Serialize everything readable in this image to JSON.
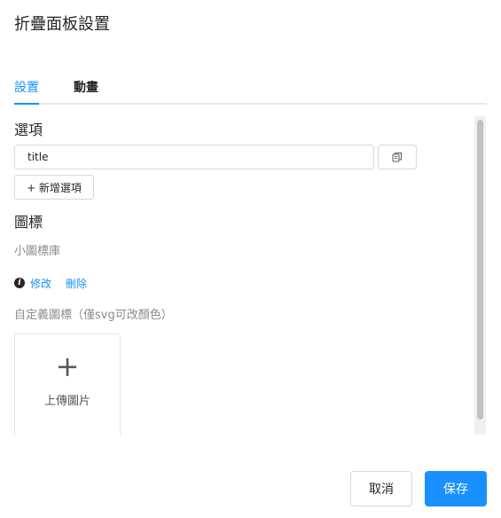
{
  "dialog": {
    "title": "折疊面板設置"
  },
  "tabs": [
    {
      "label": "設置",
      "active": true
    },
    {
      "label": "動畫",
      "active": false
    }
  ],
  "options": {
    "heading": "選項",
    "item_value": "title",
    "copy_icon": "copy-icon",
    "add_label": "+ 新增選項"
  },
  "icon_section": {
    "heading": "圖標",
    "library_label": "小圖標庫",
    "info_icon": "info-icon",
    "edit_label": "修改",
    "delete_label": "刪除",
    "custom_label": "自定義圖標（僅svg可改顏色）",
    "upload_symbol": "+",
    "upload_label": "上傳圖片"
  },
  "footer": {
    "cancel_label": "取消",
    "save_label": "保存"
  },
  "colors": {
    "accent": "#1890ff",
    "border": "#d9d9d9",
    "muted_text": "#8c8c8c"
  }
}
